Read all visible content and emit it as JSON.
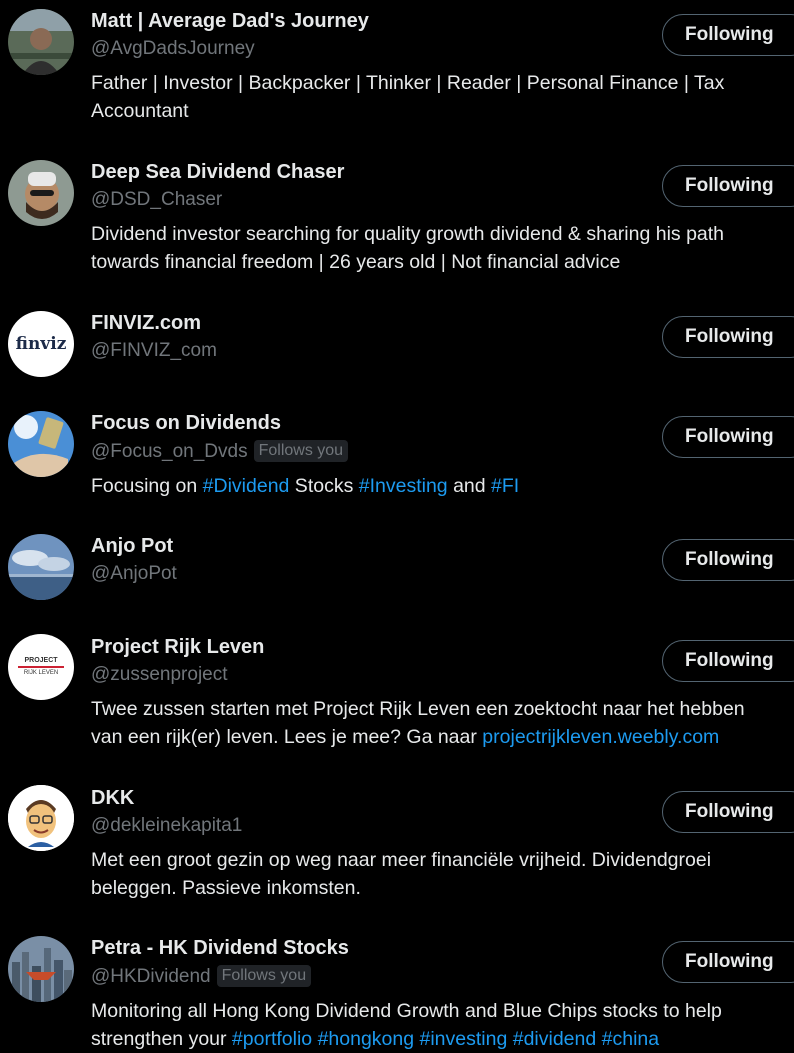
{
  "button_label": "Following",
  "follows_you_label": "Follows you",
  "colors": {
    "background": "#000000",
    "text": "#e7e9ea",
    "muted": "#71767b",
    "link": "#1d9bf0"
  },
  "accounts": [
    {
      "name": "Matt | Average Dad's Journey",
      "handle": "@AvgDadsJourney",
      "bio": [
        "Father | Investor | Backpacker | Thinker | Reader | Personal Finance | Tax",
        "Accountant"
      ]
    },
    {
      "name": "Deep Sea Dividend Chaser",
      "handle": "@DSD_Chaser",
      "bio": [
        "Dividend investor searching for quality growth dividend & sharing his path",
        "towards financial freedom | 26 years old | Not financial advice"
      ]
    },
    {
      "name": "FINVIZ.com",
      "handle": "@FINVIZ_com",
      "avatar_text": "finviz"
    },
    {
      "name": "Focus on Dividends",
      "handle": "@Focus_on_Dvds",
      "bio_parts": [
        "Focusing on ",
        "#Dividend",
        " Stocks ",
        "#Investing",
        " and ",
        "#FI"
      ]
    },
    {
      "name": "Anjo Pot",
      "handle": "@AnjoPot"
    },
    {
      "name": "Project Rijk Leven",
      "handle": "@zussenproject",
      "avatar_text": [
        "PROJECT",
        "RIJK LEVEN"
      ],
      "bio_line1": "Twee zussen starten met Project Rijk Leven een zoektocht naar het hebben",
      "bio_line2_text": "van een rijk(er) leven. Lees je mee? Ga naar ",
      "bio_link": "projectrijkleven.weebly.com"
    },
    {
      "name": "DKK",
      "handle": "@dekleinekapita1",
      "bio": [
        "Met een groot gezin op weg naar meer financiële vrijheid. Dividendgroei",
        "beleggen. Passieve inkomsten."
      ]
    },
    {
      "name": "Petra - HK Dividend Stocks",
      "handle": "@HKDividend",
      "bio_line1": "Monitoring all Hong Kong Dividend Growth and Blue Chips stocks to help",
      "bio_line2_text": "strengthen your ",
      "bio_tags": [
        "#portfolio",
        "#hongkong",
        "#investing",
        "#dividend",
        "#china"
      ]
    }
  ]
}
